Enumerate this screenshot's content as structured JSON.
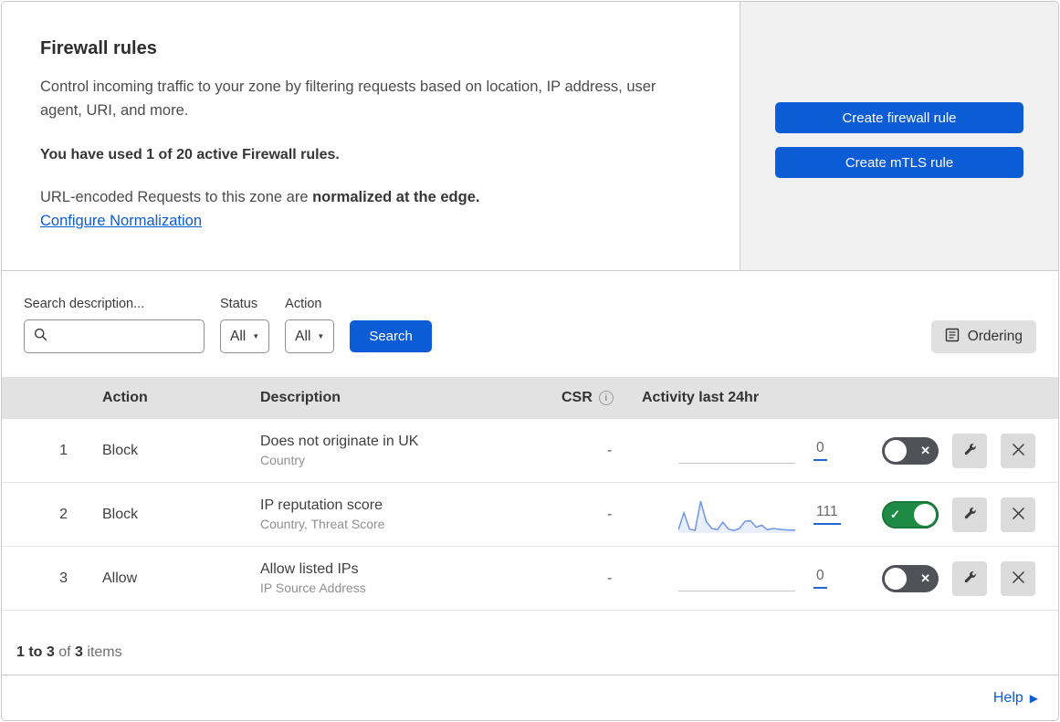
{
  "header": {
    "title": "Firewall rules",
    "description": "Control incoming traffic to your zone by filtering requests based on location, IP address, user agent, URI, and more.",
    "usage": "You have used 1 of 20 active Firewall rules.",
    "normalization_prefix": "URL-encoded Requests to this zone are ",
    "normalization_bold": "normalized at the edge.",
    "normalization_link": "Configure Normalization",
    "buttons": {
      "create_firewall": "Create firewall rule",
      "create_mtls": "Create mTLS rule"
    }
  },
  "filters": {
    "search_label": "Search description...",
    "search_value": "",
    "status_label": "Status",
    "status_value": "All",
    "action_label": "Action",
    "action_value": "All",
    "search_button": "Search",
    "ordering_button": "Ordering"
  },
  "table": {
    "columns": {
      "action": "Action",
      "description": "Description",
      "csr": "CSR",
      "activity": "Activity last 24hr"
    },
    "rows": [
      {
        "priority": "1",
        "action": "Block",
        "description": "Does not originate in UK",
        "fields": "Country",
        "csr": "-",
        "count": "0",
        "enabled": false,
        "sparkline": []
      },
      {
        "priority": "2",
        "action": "Block",
        "description": "IP reputation score",
        "fields": "Country, Threat Score",
        "csr": "-",
        "count": "111",
        "enabled": true,
        "sparkline": [
          10,
          62,
          12,
          8,
          97,
          35,
          14,
          10,
          33,
          12,
          8,
          14,
          36,
          37,
          18,
          24,
          10,
          14,
          12,
          10,
          9,
          9
        ]
      },
      {
        "priority": "3",
        "action": "Allow",
        "description": "Allow listed IPs",
        "fields": "IP Source Address",
        "csr": "-",
        "count": "0",
        "enabled": false,
        "sparkline": []
      }
    ]
  },
  "footer": {
    "range": "1 to 3",
    "of_word": "of",
    "total": "3",
    "items_word": "items",
    "help": "Help"
  },
  "icons": {
    "dropdown_caret": "▼",
    "toggle_check": "✓",
    "toggle_x": "✕",
    "help_arrow": "▶",
    "info": "i"
  },
  "colors": {
    "accent_blue": "#0b5cd5",
    "toggle_on_green": "#1e8a43",
    "toggle_off_gray": "#515257",
    "sparkline_line": "#6d96e8",
    "sparkline_fill": "#e9eefb",
    "panel_gray": "#f1f1f1",
    "table_header_gray": "#e2e2e2"
  }
}
